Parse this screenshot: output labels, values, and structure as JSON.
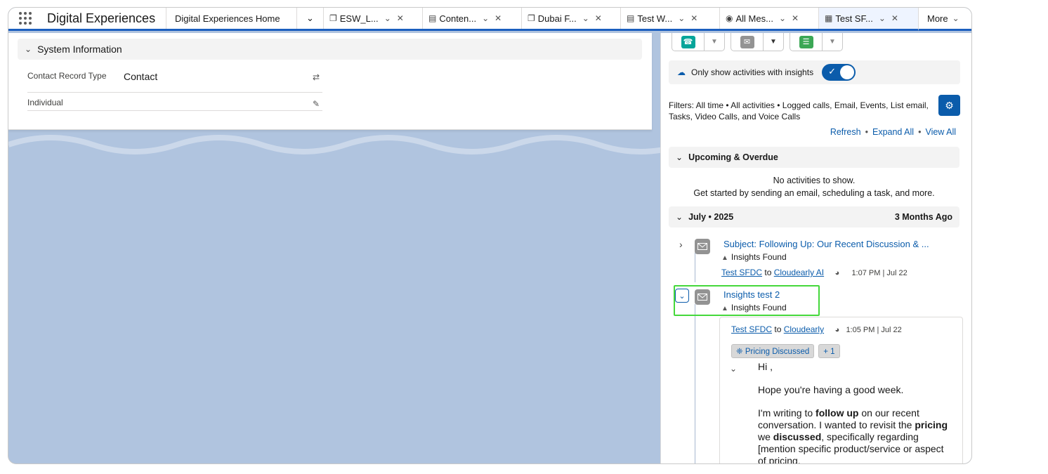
{
  "app": {
    "name": "Digital Experiences"
  },
  "tabs": [
    {
      "label": "Digital Experiences Home",
      "icon": ""
    },
    {
      "label": "",
      "icon": "chevron-down",
      "overflow": true
    },
    {
      "label": "ESW_L...",
      "icon": "copy-icon"
    },
    {
      "label": "Conten...",
      "icon": "doc-icon"
    },
    {
      "label": "Dubai F...",
      "icon": "copy-icon"
    },
    {
      "label": "Test W...",
      "icon": "doc-icon"
    },
    {
      "label": "All Mes...",
      "icon": "chat-icon"
    },
    {
      "label": "Test SF...",
      "icon": "contact-card-icon",
      "active": true
    },
    {
      "label": "More",
      "icon": ""
    }
  ],
  "system_info": {
    "heading": "System Information",
    "fields": [
      {
        "label": "Contact Record Type",
        "value": "Contact"
      },
      {
        "label": "Individual",
        "value": ""
      }
    ]
  },
  "activity": {
    "toggle_label": "Only show activities with insights",
    "filters_text": "Filters: All time • All activities • Logged calls, Email, Events, List email, Tasks, Video Calls, and Voice Calls",
    "links": {
      "refresh": "Refresh",
      "expand_all": "Expand All",
      "view_all": "View All"
    },
    "upcoming": {
      "heading": "Upcoming & Overdue",
      "empty_line1": "No activities to show.",
      "empty_line2": "Get started by sending an email, scheduling a task, and more."
    },
    "month_group": {
      "heading": "July • 2025",
      "ago": "3 Months Ago"
    },
    "items": [
      {
        "subject": "Subject: Following Up: Our Recent Discussion & ...",
        "insight": "Insights Found",
        "from": "Test SFDC",
        "to_word": "to",
        "to": "Cloudearly AI",
        "time": "1:07 PM | Jul 22"
      },
      {
        "subject": "Insights test 2",
        "insight": "Insights Found",
        "from": "Test SFDC",
        "to_word": "to",
        "to": "Cloudearly",
        "time": "1:05 PM | Jul 22",
        "pill1": "Pricing Discussed",
        "pill2": "+ 1",
        "greeting": "Hi ,",
        "para1": "Hope you're having a good week.",
        "para2_a": "I'm writing to ",
        "para2_b": "follow up",
        "para2_c": " on our recent conversation. I wanted to revisit the ",
        "para2_d": "pricing",
        "para2_e": " we ",
        "para2_f": "discussed",
        "para2_g": ", specifically regarding [mention specific product/service or aspect of pricing,"
      }
    ]
  },
  "colors": {
    "brand": "#0b5cab",
    "highlight": "#45d83b",
    "call": "#06a59a",
    "email": "#939393",
    "task": "#3ba755"
  }
}
